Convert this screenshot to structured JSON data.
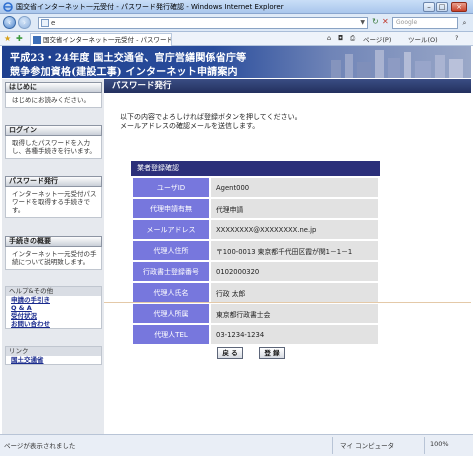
{
  "window": {
    "title": "国交省インターネット一元受付 - パスワード発行確認 - Windows Internet Explorer"
  },
  "addressbar": {
    "url": "e",
    "search_placeholder": "Google"
  },
  "tabs": {
    "active_tab": "国交省インターネット一元受付 - パスワード発行確認"
  },
  "toolbar": {
    "page_label": "ページ(P)",
    "tools_label": "ツール(O)"
  },
  "banner": {
    "line1": "平成23・24年度 国土交通省、官庁営繕関係省庁等",
    "line2": "競争参加資格(建設工事) インターネット申請案内"
  },
  "sidebar": {
    "sections": [
      {
        "header": "はじめに",
        "body": "はじめにお読みください。"
      },
      {
        "header": "ログイン",
        "body": "取得したパスワードを入力し、各種手続きを行います。"
      },
      {
        "header": "パスワード発行",
        "body": "インターネット一元受付パスワードを取得する手続きです。"
      },
      {
        "header": "手続きの概要",
        "body": "インターネット一元受付の手続について説明致します。"
      }
    ],
    "help": {
      "header": "ヘルプ&その他",
      "links": [
        "申請の手引き",
        "Q & A",
        "受付状況",
        "お問い合わせ"
      ]
    },
    "links_box": {
      "header": "リンク",
      "links": [
        "国土交通省"
      ]
    }
  },
  "main": {
    "page_title": "パスワード発行",
    "intro_line1": "以下の内容でよろしければ登録ボタンを押してください。",
    "intro_line2": "メールアドレスの確認メールを送信します。",
    "registration": {
      "header": "業者登録確認",
      "rows": [
        {
          "label": "ユーザID",
          "value": "Agent000"
        },
        {
          "label": "代理申請有無",
          "value": "代理申請"
        },
        {
          "label": "メールアドレス",
          "value": "XXXXXXXX@XXXXXXXX.ne.jp"
        },
        {
          "label": "代理人住所",
          "value": "〒100-0013 東京都千代田区霞が関1－1－1"
        },
        {
          "label": "行政書士登録番号",
          "value": "0102000320"
        },
        {
          "label": "代理人氏名",
          "value": "行政 太郎"
        },
        {
          "label": "代理人所属",
          "value": "東京都行政書士会"
        },
        {
          "label": "代理人TEL",
          "value": "03-1234-1234"
        }
      ]
    },
    "buttons": {
      "back": "戻 る",
      "register": "登 録"
    }
  },
  "statusbar": {
    "status": "ページが表示されました",
    "zone": "マイ コンピュータ",
    "zoom": "100%"
  }
}
